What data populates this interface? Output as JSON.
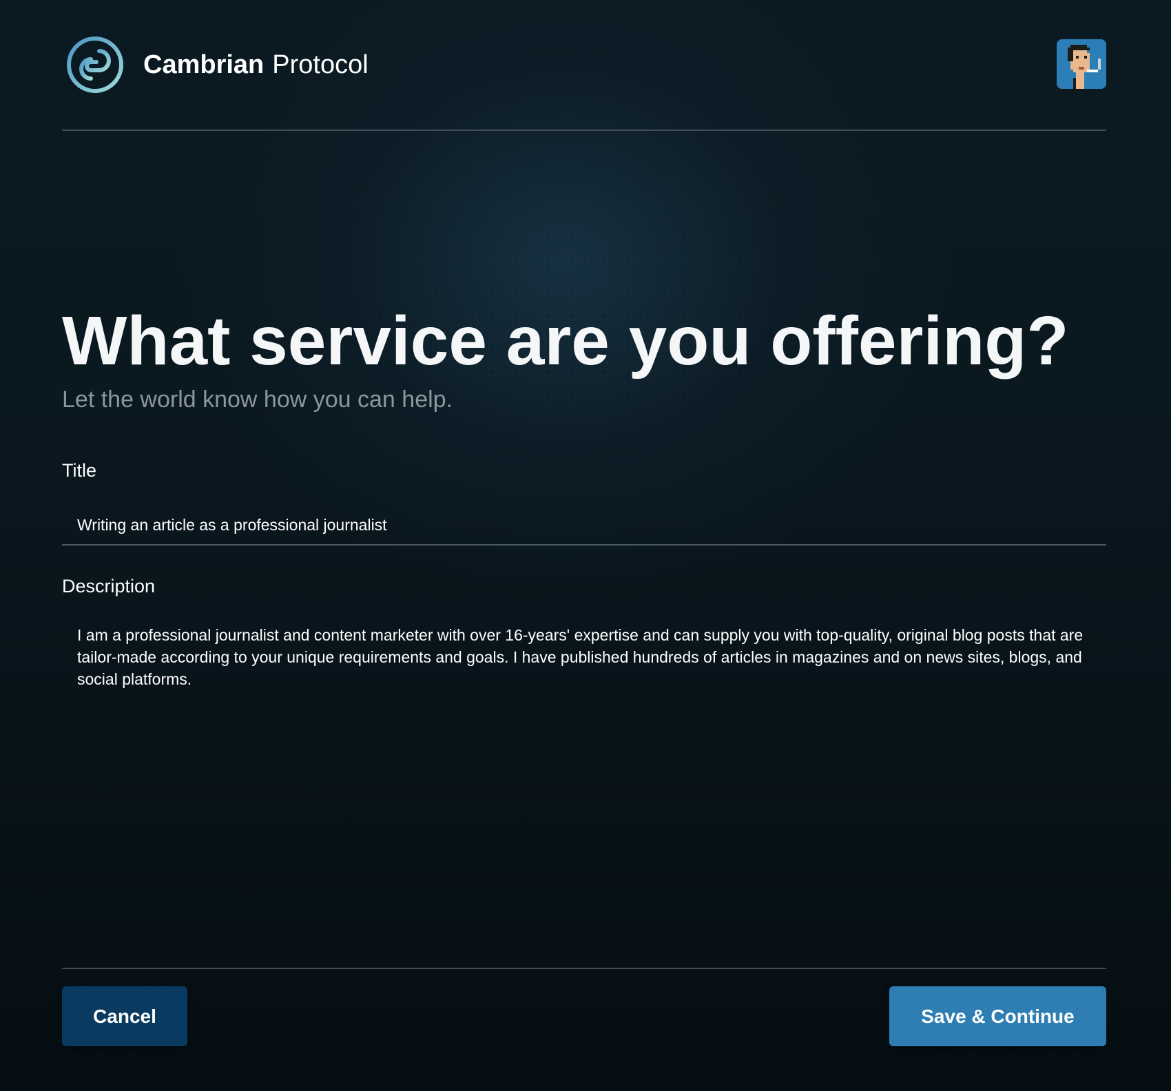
{
  "header": {
    "brand_primary": "Cambrian",
    "brand_secondary": "Protocol",
    "logo_icon": "cambrian-logo-icon",
    "avatar_icon": "pixel-avatar-icon"
  },
  "main": {
    "heading": "What service are you offering?",
    "subtitle": "Let the world know how you can help."
  },
  "form": {
    "title_label": "Title",
    "title_value": "Writing an article as a professional journalist",
    "description_label": "Description",
    "description_value": "I am a professional journalist and content marketer with over 16-years' expertise and can supply you with top-quality, original blog posts that are tailor-made according to your unique requirements and goals. I have published hundreds of articles in magazines and on news sites, blogs, and social platforms."
  },
  "footer": {
    "cancel_label": "Cancel",
    "save_label": "Save & Continue"
  },
  "colors": {
    "background": "#0a171e",
    "accent": "#2e7db3",
    "cancel_button": "#0a3a5f",
    "subtitle_text": "#8b979e"
  }
}
